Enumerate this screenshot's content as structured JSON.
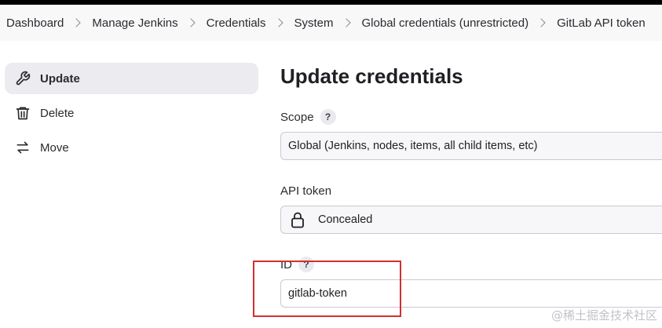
{
  "breadcrumb": {
    "items": [
      "Dashboard",
      "Manage Jenkins",
      "Credentials",
      "System",
      "Global credentials (unrestricted)",
      "GitLab API token"
    ]
  },
  "sidebar": {
    "items": [
      {
        "label": "Update",
        "icon": "wrench-icon",
        "active": true
      },
      {
        "label": "Delete",
        "icon": "trash-icon",
        "active": false
      },
      {
        "label": "Move",
        "icon": "arrows-swap-icon",
        "active": false
      }
    ]
  },
  "main": {
    "title": "Update credentials",
    "scope": {
      "label": "Scope",
      "help": "?",
      "value": "Global (Jenkins, nodes, items, all child items, etc)"
    },
    "api_token": {
      "label": "API token",
      "value": "Concealed",
      "icon": "lock-icon"
    },
    "id": {
      "label": "ID",
      "help": "?",
      "value": "gitlab-token"
    }
  },
  "annotation": {
    "color": "#d32f2f"
  },
  "watermark": "@稀土掘金技术社区",
  "colors": {
    "topbar": "#000000",
    "breadcrumb_bg": "#f8f8f9",
    "sidebar_active_bg": "#ebebf0"
  }
}
